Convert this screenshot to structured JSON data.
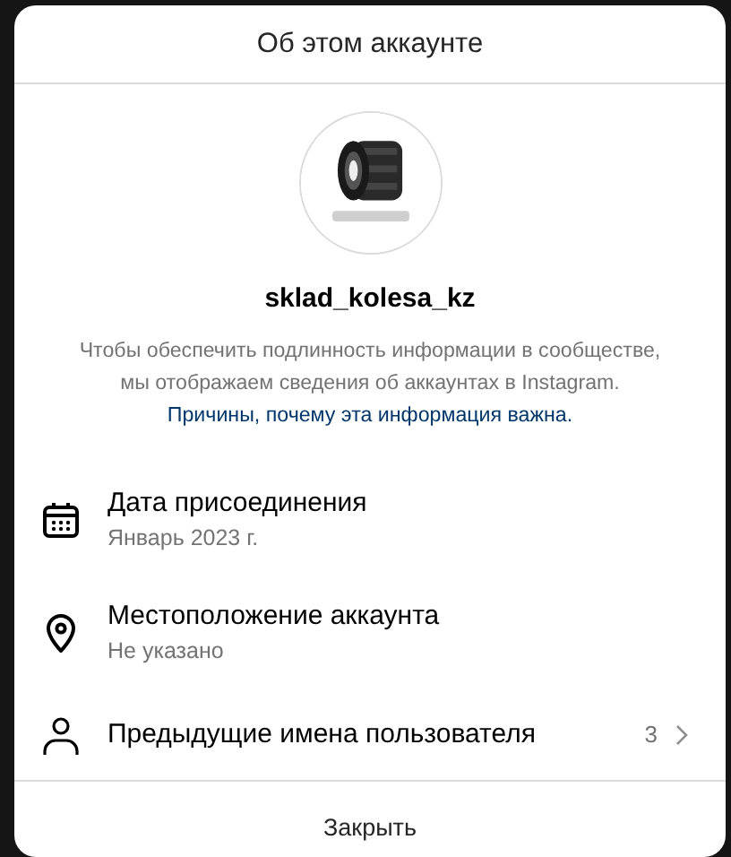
{
  "dialog": {
    "title": "Об этом аккаунте"
  },
  "profile": {
    "username": "sklad_kolesa_kz",
    "description": "Чтобы обеспечить подлинность информации в сообществе, мы отображаем сведения об аккаунтах в Instagram.",
    "link": "Причины, почему эта информация важна."
  },
  "items": [
    {
      "kind": "date",
      "title": "Дата присоединения",
      "value": "Январь 2023 г."
    },
    {
      "kind": "location",
      "title": "Местоположение аккаунта",
      "value": "Не указано"
    },
    {
      "kind": "names",
      "title": "Предыдущие имена пользователя",
      "count": "3"
    }
  ],
  "close_button": "Закрыть"
}
